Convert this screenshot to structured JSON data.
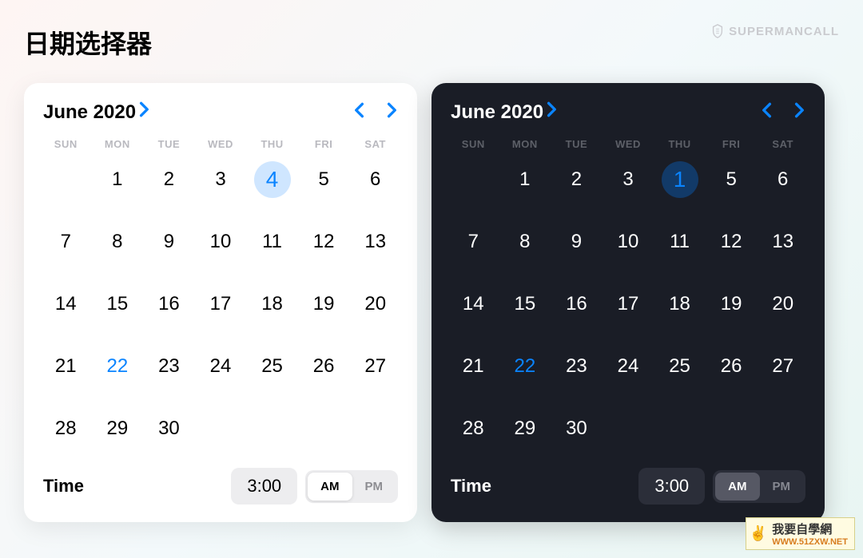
{
  "brand": {
    "name": "SUPERMANCALL"
  },
  "title": "日期选择器",
  "dow": [
    "SUN",
    "MON",
    "TUE",
    "WED",
    "THU",
    "FRI",
    "SAT"
  ],
  "light": {
    "month": "June 2020",
    "selected": 4,
    "today": 22,
    "leading_blanks": 1,
    "days_in_month": 30,
    "time_label": "Time",
    "time_value": "3:00",
    "am_label": "AM",
    "pm_label": "PM",
    "ampm_active": "AM"
  },
  "dark": {
    "month": "June 2020",
    "selected": 1,
    "selected_col": 4,
    "today": 22,
    "leading_blanks": 1,
    "days_in_month": 30,
    "time_label": "Time",
    "time_value": "3:00",
    "am_label": "AM",
    "pm_label": "PM",
    "ampm_active": "AM"
  },
  "watermark": {
    "line1": "我要自學網",
    "line2": "WWW.51ZXW.NET"
  }
}
